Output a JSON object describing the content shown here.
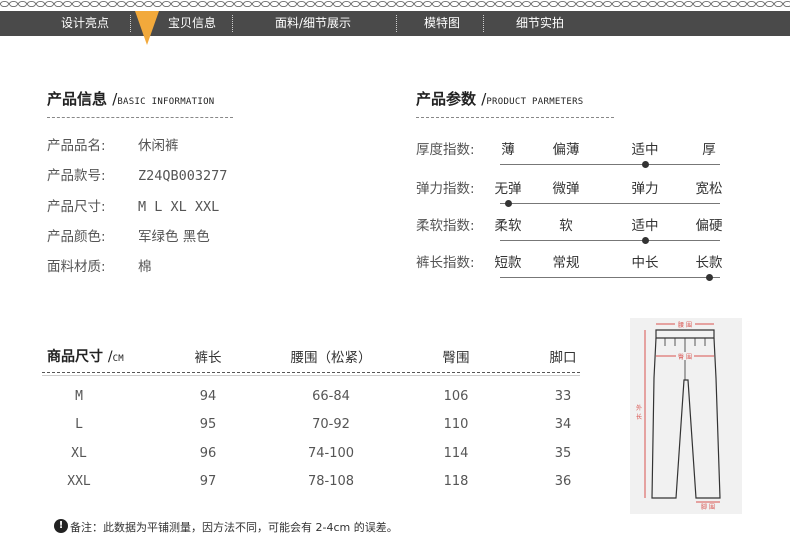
{
  "nav": {
    "tabs": [
      {
        "label": "设计亮点"
      },
      {
        "label": "宝贝信息",
        "active": true
      },
      {
        "label": "面料/细节展示"
      },
      {
        "label": "模特图"
      },
      {
        "label": "细节实拍"
      }
    ],
    "active_color": "#f2a93b",
    "bar_color": "#4a4a4a"
  },
  "product_info": {
    "title": "产品信息",
    "slash": "/",
    "title_en": "BASIC INFORMATION",
    "rows": [
      {
        "label": "产品品名:",
        "value": "休闲裤"
      },
      {
        "label": "产品款号:",
        "value": "Z24QB003277"
      },
      {
        "label": "产品尺寸:",
        "value": "M L XL XXL"
      },
      {
        "label": "产品颜色:",
        "value": "军绿色 黑色"
      },
      {
        "label": "面料材质:",
        "value": "棉"
      }
    ]
  },
  "product_params": {
    "title": "产品参数",
    "slash": "/",
    "title_en": "PRODUCT PARMETERS",
    "rows": [
      {
        "label": "厚度指数:",
        "options": [
          "薄",
          "偏薄",
          "适中",
          "厚"
        ],
        "selected": 2
      },
      {
        "label": "弹力指数:",
        "options": [
          "无弹",
          "微弹",
          "弹力",
          "宽松"
        ],
        "selected": 0
      },
      {
        "label": "柔软指数:",
        "options": [
          "柔软",
          "软",
          "适中",
          "偏硬"
        ],
        "selected": 2
      },
      {
        "label": "裤长指数:",
        "options": [
          "短款",
          "常规",
          "中长",
          "长款"
        ],
        "selected": 3
      }
    ]
  },
  "size_table": {
    "title": "商品尺寸",
    "slash": "/",
    "unit": "CM",
    "headers": [
      "裤长",
      "腰围（松紧）",
      "臀围",
      "脚口"
    ],
    "rows": [
      {
        "size": "M",
        "values": [
          "94",
          "66-84",
          "106",
          "33"
        ]
      },
      {
        "size": "L",
        "values": [
          "95",
          "70-92",
          "110",
          "34"
        ]
      },
      {
        "size": "XL",
        "values": [
          "96",
          "74-100",
          "114",
          "35"
        ]
      },
      {
        "size": "XXL",
        "values": [
          "97",
          "78-108",
          "118",
          "36"
        ]
      }
    ]
  },
  "diagram": {
    "waist_label": "腰 围",
    "hip_label": "臀 围",
    "length_label_1": "外",
    "length_label_2": "长",
    "hem_label": "脚 围",
    "accent": "#d9534f"
  },
  "note": {
    "icon": "!",
    "text": "备注：此数据为平铺测量，因方法不同，可能会有 2-4cm 的误差。"
  }
}
